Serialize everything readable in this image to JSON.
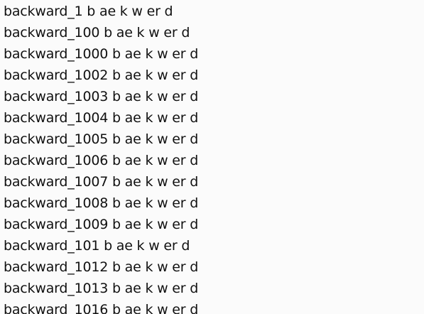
{
  "lines": [
    "backward_1 b ae k w er d",
    "backward_100 b ae k w er d",
    "backward_1000 b ae k w er d",
    "backward_1002 b ae k w er d",
    "backward_1003 b ae k w er d",
    "backward_1004 b ae k w er d",
    "backward_1005 b ae k w er d",
    "backward_1006 b ae k w er d",
    "backward_1007 b ae k w er d",
    "backward_1008 b ae k w er d",
    "backward_1009 b ae k w er d",
    "backward_101 b ae k w er d",
    "backward_1012 b ae k w er d",
    "backward_1013 b ae k w er d",
    "backward_1016 b ae k w er d"
  ]
}
